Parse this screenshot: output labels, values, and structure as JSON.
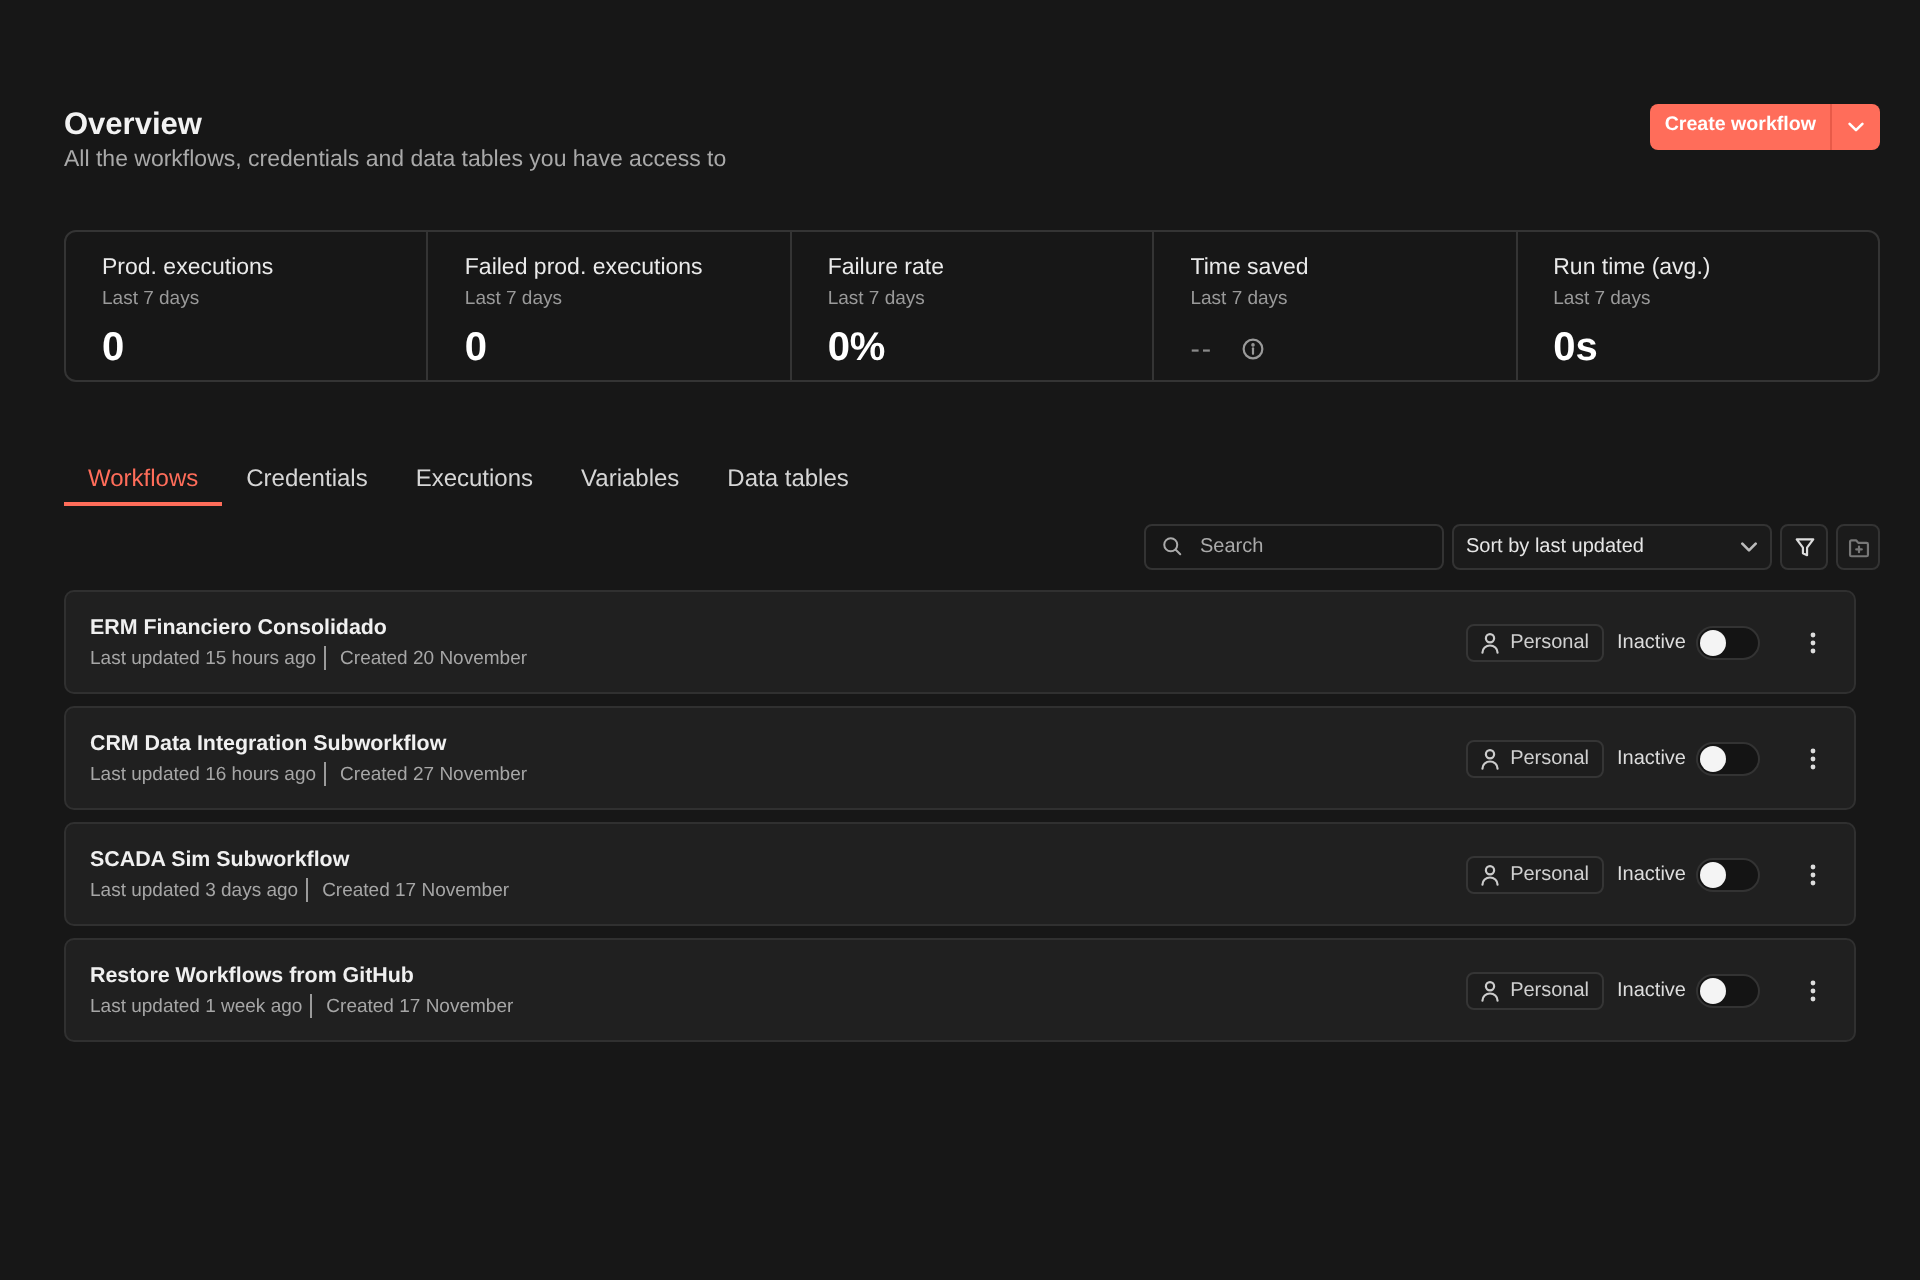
{
  "header": {
    "title": "Overview",
    "subtitle": "All the workflows, credentials and data tables you have access to",
    "create_button": {
      "label": "Create workflow"
    }
  },
  "stats": [
    {
      "label": "Prod. executions",
      "period": "Last 7 days",
      "value": "0",
      "kind": "number"
    },
    {
      "label": "Failed prod. executions",
      "period": "Last 7 days",
      "value": "0",
      "kind": "number"
    },
    {
      "label": "Failure rate",
      "period": "Last 7 days",
      "value": "0%",
      "kind": "number"
    },
    {
      "label": "Time saved",
      "period": "Last 7 days",
      "value": "--",
      "kind": "unavailable"
    },
    {
      "label": "Run time (avg.)",
      "period": "Last 7 days",
      "value": "0s",
      "kind": "number"
    }
  ],
  "tabs": [
    {
      "label": "Workflows",
      "selected": true
    },
    {
      "label": "Credentials",
      "selected": false
    },
    {
      "label": "Executions",
      "selected": false
    },
    {
      "label": "Variables",
      "selected": false
    },
    {
      "label": "Data tables",
      "selected": false
    }
  ],
  "toolbar": {
    "search": {
      "placeholder": "Search"
    },
    "sort": {
      "value": "Sort by last updated"
    }
  },
  "workflows": [
    {
      "name": "ERM Financiero Consolidado",
      "updated": "Last updated 15 hours ago",
      "created": "Created 20 November",
      "owner": "Personal",
      "status": "Inactive",
      "active": false
    },
    {
      "name": "CRM Data Integration Subworkflow",
      "updated": "Last updated 16 hours ago",
      "created": "Created 27 November",
      "owner": "Personal",
      "status": "Inactive",
      "active": false
    },
    {
      "name": "SCADA Sim Subworkflow",
      "updated": "Last updated 3 days ago",
      "created": "Created 17 November",
      "owner": "Personal",
      "status": "Inactive",
      "active": false
    },
    {
      "name": "Restore Workflows from GitHub",
      "updated": "Last updated 1 week ago",
      "created": "Created 17 November",
      "owner": "Personal",
      "status": "Inactive",
      "active": false
    }
  ]
}
